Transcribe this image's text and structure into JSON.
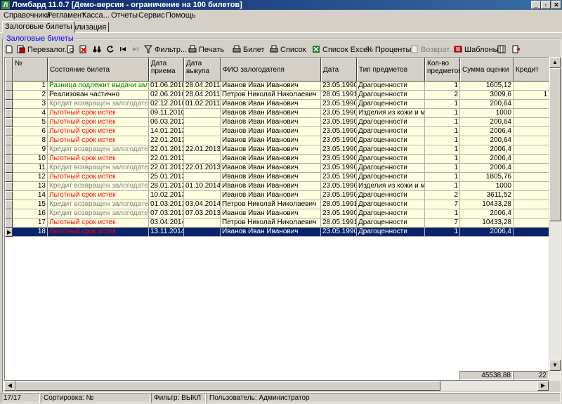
{
  "window": {
    "title": "Ломбард 11.0.7  [Демо-версия - ограничение на 100 билетов]"
  },
  "menu": [
    "Справочники",
    "Регламент",
    "Касса...",
    "Отчеты",
    "Сервис",
    "Помощь"
  ],
  "tabs": [
    "Залоговые билеты",
    "Реализация"
  ],
  "group_label": "Залоговые билеты",
  "toolbar": {
    "pereza_label": "Перезалог...",
    "filter_label": "Фильтр...",
    "print_label": "Печать",
    "bilet_label": "Билет",
    "list_label": "Список",
    "excel_label": "Список Excel",
    "percent_label": "% Проценты...",
    "return_label": "Возврат...",
    "templates_label": "Шаблоны"
  },
  "columns": [
    "№",
    "Состояние билета",
    "Дата приема",
    "Дата выкупа",
    "ФИО залогодателя",
    "Дата рожд.",
    "Тип предметов залога",
    "Кол-во предметов",
    "Сумма оценки",
    "Кредит"
  ],
  "colors": {
    "green": "#008000",
    "gray": "#808080",
    "red": "#ff0000",
    "black": "#000000",
    "row_bg": "#ffffe0",
    "selected_bg": "#0a246a"
  },
  "rows": [
    {
      "num": "1",
      "state": "Разница подлежит выдачи залогодателю",
      "color": "green",
      "recv": "01.06.2010",
      "buy": "28.04.2011",
      "name": "Иванов Иван Иванович",
      "birth": "23.05.1990",
      "type": "Драгоценности",
      "qty": "1",
      "sum": "1605,12",
      "credit": ""
    },
    {
      "num": "2",
      "state": "Реализован частично",
      "color": "black",
      "recv": "02.06.2010",
      "buy": "28.04.2011",
      "name": "Петров Николай Николаевич",
      "birth": "28.05.1991",
      "type": "Драгоценности",
      "qty": "2",
      "sum": "3009,6",
      "credit": "1"
    },
    {
      "num": "3",
      "state": "Кредит возвращен залогодателем",
      "color": "gray",
      "recv": "02.12.2010",
      "buy": "01.02.2011",
      "name": "Иванов Иван Иванович",
      "birth": "23.05.1990",
      "type": "Драгоценности",
      "qty": "1",
      "sum": "200,64",
      "credit": ""
    },
    {
      "num": "4",
      "state": "Льготный срок истек",
      "color": "red",
      "recv": "09.11.2010",
      "buy": "",
      "name": "Иванов Иван Иванович",
      "birth": "23.05.1990",
      "type": "Изделия из кожи и меха",
      "qty": "1",
      "sum": "1000",
      "credit": ""
    },
    {
      "num": "5",
      "state": "Льготный срок истек",
      "color": "red",
      "recv": "06.03.2012",
      "buy": "",
      "name": "Иванов Иван Иванович",
      "birth": "23.05.1990",
      "type": "Драгоценности",
      "qty": "1",
      "sum": "200,64",
      "credit": ""
    },
    {
      "num": "6",
      "state": "Льготный срок истек",
      "color": "red",
      "recv": "14.01.2013",
      "buy": "",
      "name": "Иванов Иван Иванович",
      "birth": "23.05.1990",
      "type": "Драгоценности",
      "qty": "1",
      "sum": "2006,4",
      "credit": ""
    },
    {
      "num": "8",
      "state": "Льготный срок истек",
      "color": "red",
      "recv": "22.01.2013",
      "buy": "",
      "name": "Иванов Иван Иванович",
      "birth": "23.05.1990",
      "type": "Драгоценности",
      "qty": "1",
      "sum": "200,64",
      "credit": ""
    },
    {
      "num": "9",
      "state": "Кредит возвращен залогодателем",
      "color": "gray",
      "recv": "22.01.2013",
      "buy": "22.01.2013",
      "name": "Иванов Иван Иванович",
      "birth": "23.05.1990",
      "type": "Драгоценности",
      "qty": "1",
      "sum": "2006,4",
      "credit": ""
    },
    {
      "num": "10",
      "state": "Льготный срок истек",
      "color": "red",
      "recv": "22.01.2013",
      "buy": "",
      "name": "Иванов Иван Иванович",
      "birth": "23.05.1990",
      "type": "Драгоценности",
      "qty": "1",
      "sum": "2006,4",
      "credit": ""
    },
    {
      "num": "11",
      "state": "Кредит возвращен залогодателем",
      "color": "gray",
      "recv": "22.01.2013",
      "buy": "22.01.2013",
      "name": "Иванов Иван Иванович",
      "birth": "23.05.1990",
      "type": "Драгоценности",
      "qty": "1",
      "sum": "2006,4",
      "credit": ""
    },
    {
      "num": "12",
      "state": "Льготный срок истек",
      "color": "red",
      "recv": "25.01.2013",
      "buy": "",
      "name": "Иванов Иван Иванович",
      "birth": "23.05.1990",
      "type": "Драгоценности",
      "qty": "1",
      "sum": "1805,76",
      "credit": ""
    },
    {
      "num": "13",
      "state": "Кредит возвращен залогодателем",
      "color": "gray",
      "recv": "28.01.2013",
      "buy": "01.10.2014",
      "name": "Иванов Иван Иванович",
      "birth": "23.05.1990",
      "type": "Изделия из кожи и меха",
      "qty": "1",
      "sum": "1000",
      "credit": ""
    },
    {
      "num": "14",
      "state": "Льготный срок истек",
      "color": "red",
      "recv": "10.02.2013",
      "buy": "",
      "name": "Иванов Иван Иванович",
      "birth": "23.05.1990",
      "type": "Драгоценности",
      "qty": "2",
      "sum": "3611,52",
      "credit": ""
    },
    {
      "num": "15",
      "state": "Кредит возвращен залогодателем",
      "color": "gray",
      "recv": "01.03.2013",
      "buy": "03.04.2014",
      "name": "Петров Николай Николаевич",
      "birth": "28.05.1991",
      "type": "Драгоценности",
      "qty": "7",
      "sum": "10433,28",
      "credit": ""
    },
    {
      "num": "16",
      "state": "Кредит возвращен залогодателем",
      "color": "gray",
      "recv": "07.03.2013",
      "buy": "07.03.2013",
      "name": "Иванов Иван Иванович",
      "birth": "23.05.1990",
      "type": "Драгоценности",
      "qty": "1",
      "sum": "2006,4",
      "credit": ""
    },
    {
      "num": "17",
      "state": "Льготный срок истек",
      "color": "red",
      "recv": "03.04.2014",
      "buy": "",
      "name": "Петров Николай Николаевич",
      "birth": "28.05.1991",
      "type": "Драгоценности",
      "qty": "7",
      "sum": "10433,28",
      "credit": ""
    },
    {
      "num": "18",
      "state": "Льготный срок истек",
      "color": "red",
      "recv": "13.11.2014",
      "buy": "",
      "name": "Иванов Иван Иванович",
      "birth": "23.05.1990",
      "type": "Драгоценности",
      "qty": "1",
      "sum": "2006,4",
      "credit": "",
      "selected": true
    }
  ],
  "footer": {
    "sum_total": "45538,88",
    "credit_total": "22"
  },
  "status": {
    "count": "17/17",
    "sort": "Сортировка: №",
    "filter": "Фильтр: ВЫКЛ",
    "user": "Пользователь: Администратор"
  }
}
